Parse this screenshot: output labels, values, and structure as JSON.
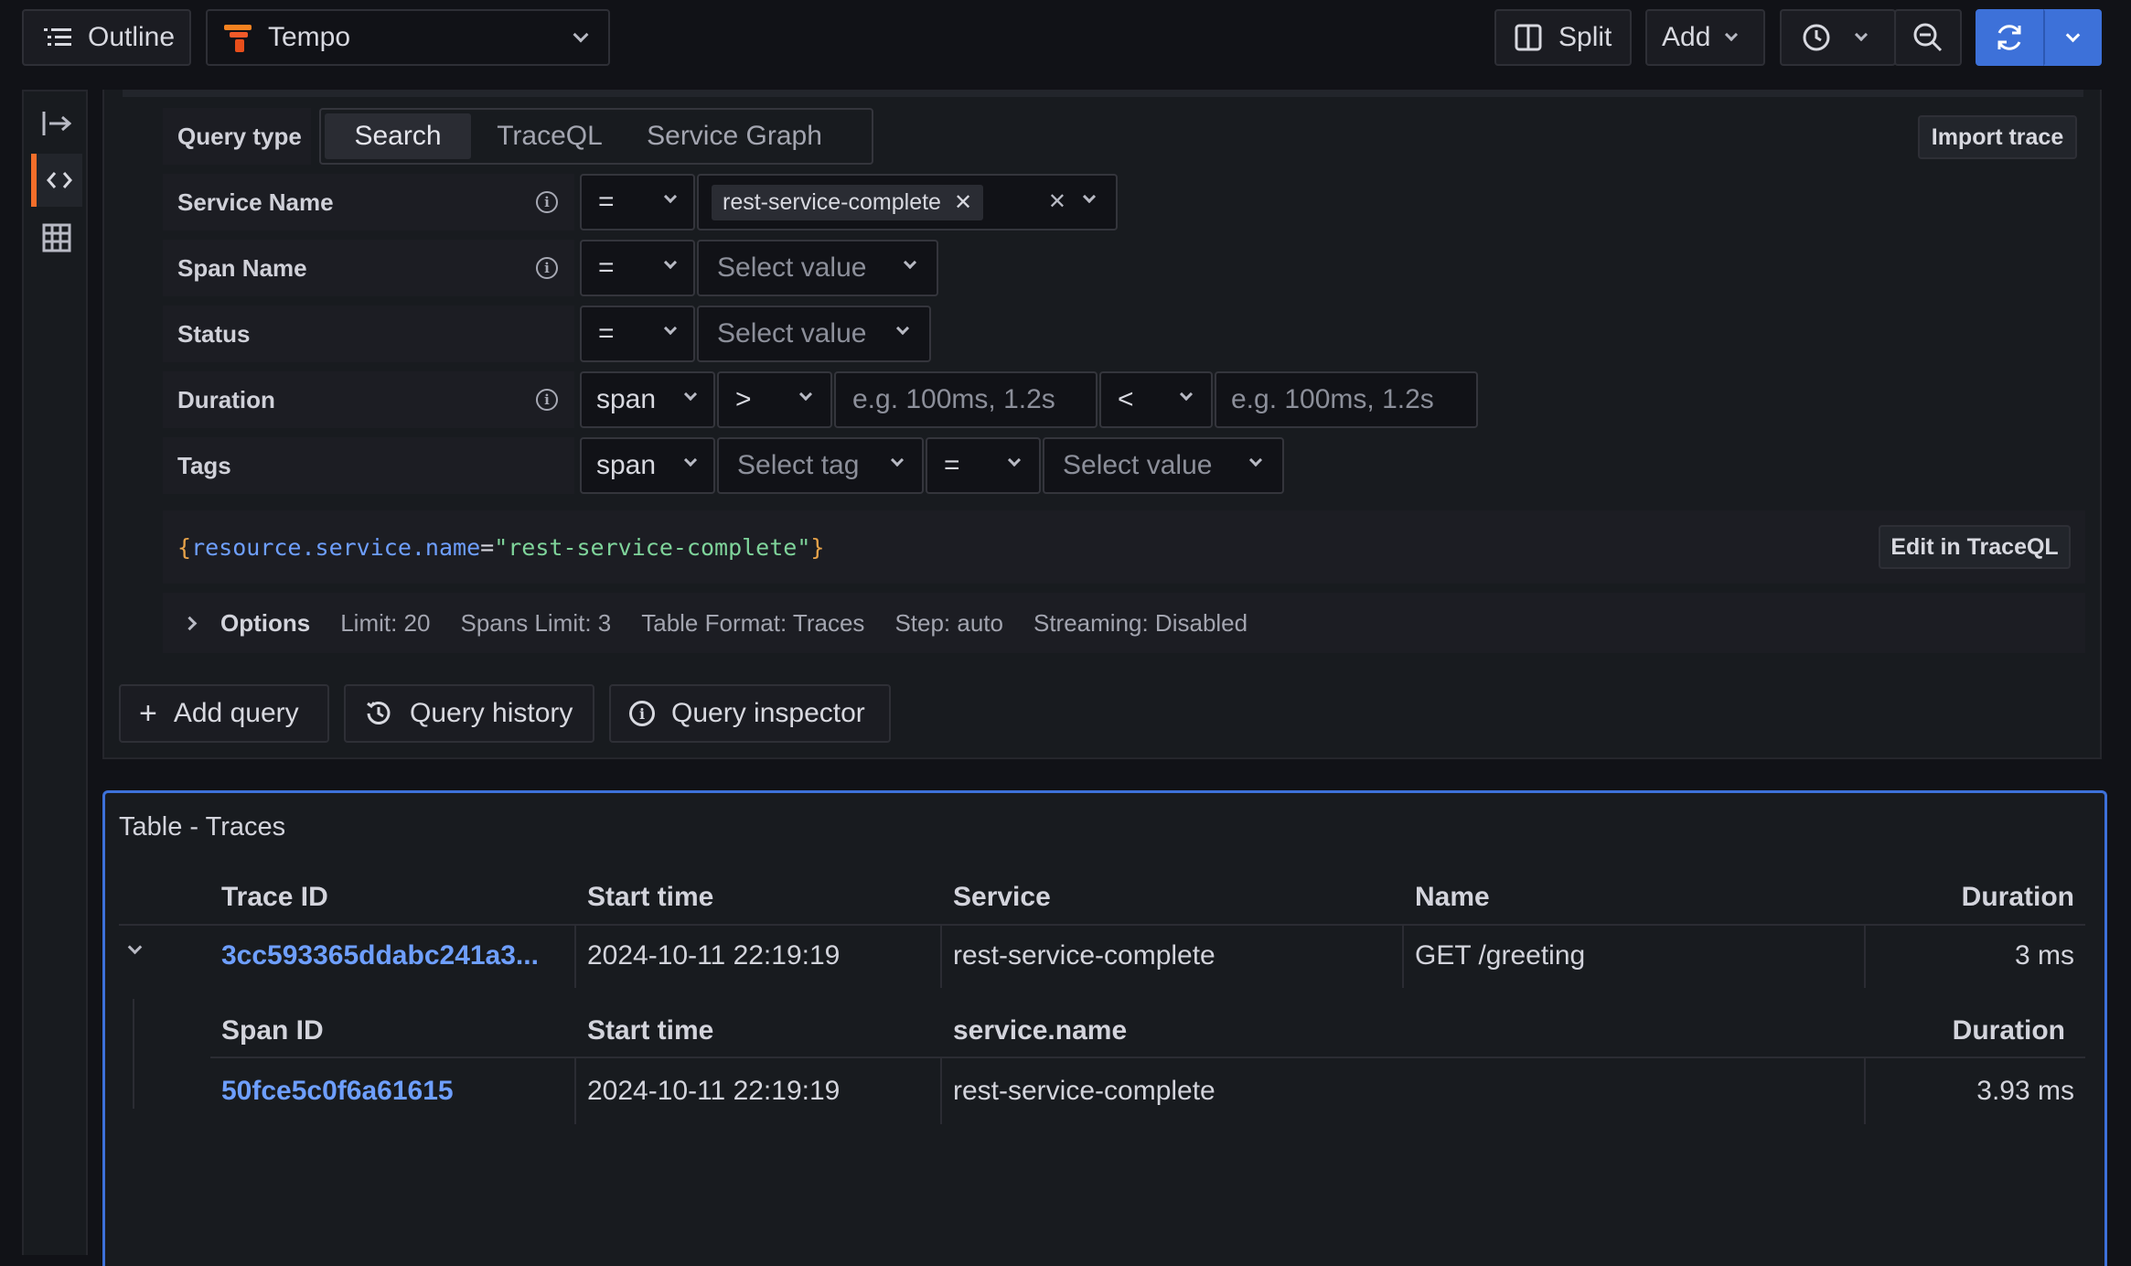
{
  "topbar": {
    "outline_label": "Outline",
    "datasource": "Tempo",
    "split_label": "Split",
    "add_label": "Add"
  },
  "query": {
    "query_type_label": "Query type",
    "tabs": [
      "Search",
      "TraceQL",
      "Service Graph"
    ],
    "import_trace_label": "Import trace",
    "rows": {
      "service_name": {
        "label": "Service Name",
        "operator": "=",
        "value_chip": "rest-service-complete"
      },
      "span_name": {
        "label": "Span Name",
        "operator": "=",
        "placeholder": "Select value"
      },
      "status": {
        "label": "Status",
        "operator": "=",
        "placeholder": "Select value"
      },
      "duration": {
        "label": "Duration",
        "scope": "span",
        "op_min": ">",
        "min_placeholder": "e.g. 100ms, 1.2s",
        "op_max": "<",
        "max_placeholder": "e.g. 100ms, 1.2s"
      },
      "tags": {
        "label": "Tags",
        "scope": "span",
        "tag_placeholder": "Select tag",
        "operator": "=",
        "value_placeholder": "Select value"
      }
    },
    "traceql": {
      "open_brace": "{",
      "attr": "resource.service.name",
      "eq": "=",
      "value": "\"rest-service-complete\"",
      "close_brace": "}"
    },
    "edit_in_traceql_label": "Edit in TraceQL",
    "options": {
      "label": "Options",
      "limit": "Limit: 20",
      "spans_limit": "Spans Limit: 3",
      "table_format": "Table Format: Traces",
      "step": "Step: auto",
      "streaming": "Streaming: Disabled"
    },
    "add_query_label": "Add query",
    "query_history_label": "Query history",
    "query_inspector_label": "Query inspector"
  },
  "table": {
    "title": "Table - Traces",
    "columns": [
      "Trace ID",
      "Start time",
      "Service",
      "Name",
      "Duration"
    ],
    "trace_row": {
      "trace_id": "3cc593365ddabc241a3...",
      "start_time": "2024-10-11 22:19:19",
      "service": "rest-service-complete",
      "name": "GET /greeting",
      "duration": "3 ms"
    },
    "span_columns": [
      "Span ID",
      "Start time",
      "service.name",
      "Duration"
    ],
    "span_row": {
      "span_id": "50fce5c0f6a61615",
      "start_time": "2024-10-11 22:19:19",
      "service_name": "rest-service-complete",
      "duration": "3.93 ms"
    }
  },
  "colors": {
    "accent": "#3d71d9",
    "link": "#6e9fff",
    "tempo_orange": "#f15a29"
  }
}
